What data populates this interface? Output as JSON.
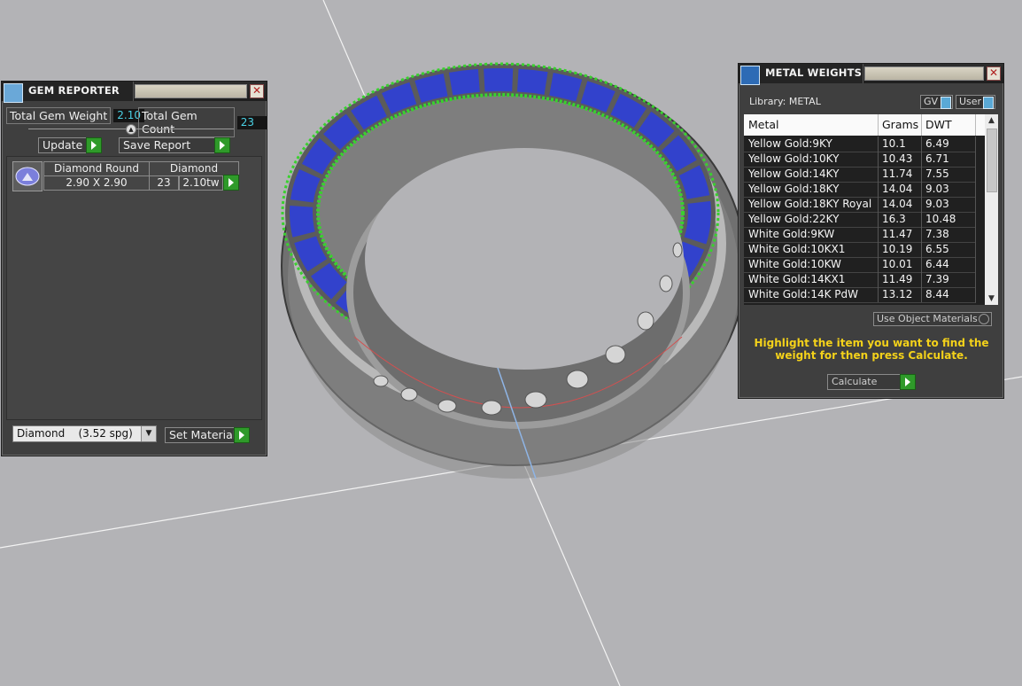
{
  "gem_reporter": {
    "title": "GEM REPORTER",
    "total_weight_label": "Total Gem Weight",
    "total_weight_value": "2.10",
    "total_count_label": "Total Gem Count",
    "total_count_value": "23",
    "update_label": "Update",
    "save_report_label": "Save Report",
    "gems": [
      {
        "shape": "Diamond Round",
        "material": "Diamond",
        "size": "2.90 X 2.90",
        "count": "23",
        "weight": "2.10tw"
      }
    ],
    "material_select": "Diamond    (3.52 spg)",
    "set_material_label": "Set Material"
  },
  "metal_weights": {
    "title": "METAL WEIGHTS",
    "library_label": "Library: METAL",
    "toggle_gv": "GV",
    "toggle_user": "User",
    "columns": [
      "Metal",
      "Grams",
      "DWT"
    ],
    "rows": [
      [
        "Yellow Gold:9KY",
        "10.1",
        "6.49"
      ],
      [
        "Yellow Gold:10KY",
        "10.43",
        "6.71"
      ],
      [
        "Yellow Gold:14KY",
        "11.74",
        "7.55"
      ],
      [
        "Yellow Gold:18KY",
        "14.04",
        "9.03"
      ],
      [
        "Yellow Gold:18KY Royal",
        "14.04",
        "9.03"
      ],
      [
        "Yellow Gold:22KY",
        "16.3",
        "10.48"
      ],
      [
        "White Gold:9KW",
        "11.47",
        "7.38"
      ],
      [
        "White Gold:10KX1",
        "10.19",
        "6.55"
      ],
      [
        "White Gold:10KW",
        "10.01",
        "6.44"
      ],
      [
        "White Gold:14KX1",
        "11.49",
        "7.39"
      ],
      [
        "White Gold:14K PdW",
        "13.12",
        "8.44"
      ]
    ],
    "use_object_materials": "Use Object Materials",
    "hint": "Highlight the item you want to find the weight for then press Calculate.",
    "calculate_label": "Calculate"
  },
  "colors": {
    "panel_bg": "#3f3f3f",
    "hint_yellow": "#f4d21a",
    "value_cyan": "#4ad2e6",
    "go_green": "#2f9a2a",
    "gem_blue": "#2e3fd8",
    "prong_green": "#39d12e"
  }
}
